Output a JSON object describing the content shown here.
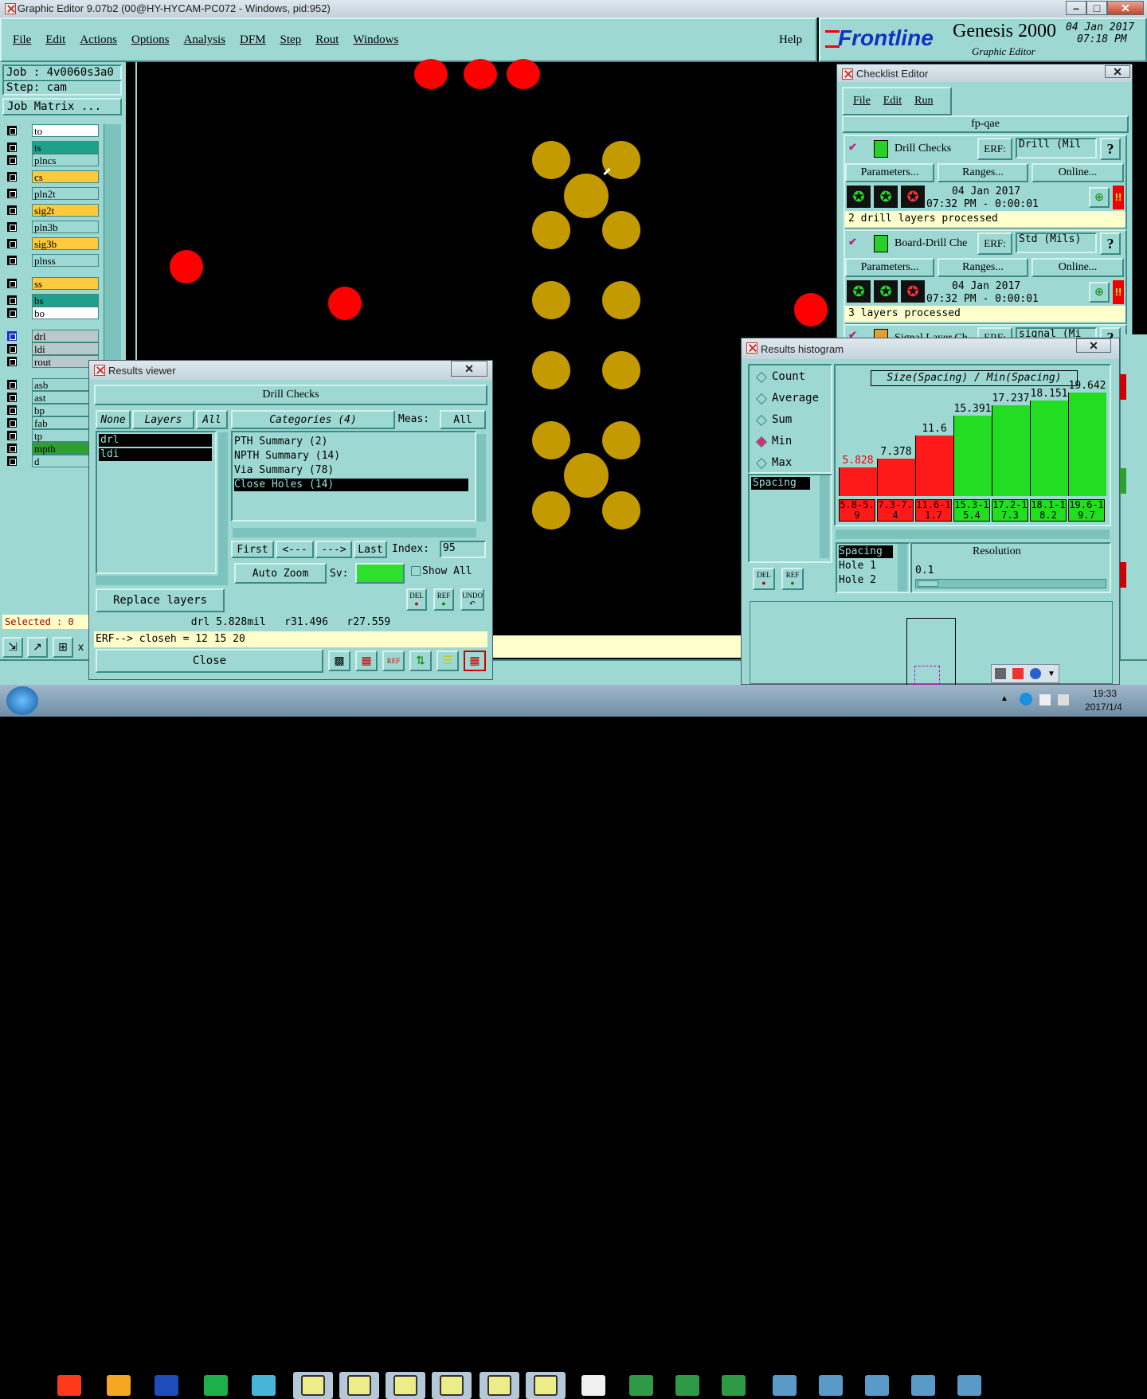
{
  "window": {
    "title": "Graphic Editor 9.07b2 (00@HY-HYCAM-PC072 - Windows, pid:952)"
  },
  "menu": {
    "items": [
      "File",
      "Edit",
      "Actions",
      "Options",
      "Analysis",
      "DFM",
      "Step",
      "Rout",
      "Windows"
    ],
    "help": "Help"
  },
  "brand": {
    "logo": "Frontline",
    "product": "Genesis 2000",
    "subtitle": "Graphic Editor",
    "date": "04 Jan 2017",
    "time": "07:18 PM"
  },
  "job": {
    "job": "Job : 4v0060s3a0",
    "step": "Step: cam",
    "matrix": "Job Matrix ..."
  },
  "layers": [
    "to",
    "ts",
    "plncs",
    "cs",
    "pln2t",
    "sig2t",
    "pln3b",
    "sig3b",
    "plnss",
    "ss",
    "bs",
    "bo",
    "drl",
    "ldi",
    "rout",
    "asb",
    "ast",
    "bp",
    "fab",
    "tp",
    "mpth",
    "d"
  ],
  "layer_colors": {
    "to": "#ffffff",
    "ts": "#1fa08c",
    "cs": "#ffc93c",
    "sig2t": "#ffc93c",
    "sig3b": "#ffc93c",
    "ss": "#ffc93c",
    "bs": "#1fa08c",
    "bo": "#ffffff",
    "drl": "#b9c9cb",
    "ldi": "#b9c9cb",
    "rout": "#b9c9cb",
    "mpth": "#2fa02f"
  },
  "selected": "Selected : 0",
  "checklist": {
    "title": "Checklist Editor",
    "menu": [
      "File",
      "Edit",
      "Run"
    ],
    "name": "fp-qae",
    "checks": [
      {
        "name": "Drill Checks",
        "erf_label": "ERF:",
        "erf": "Drill (Mil",
        "params": "Parameters...",
        "ranges": "Ranges...",
        "online": "Online...",
        "date": "04 Jan 2017",
        "time": "07:32 PM - 0:00:01",
        "status": "2 drill layers processed",
        "help": "?"
      },
      {
        "name": "Board-Drill Che",
        "erf_label": "ERF:",
        "erf": "Std (Mils)",
        "params": "Parameters...",
        "ranges": "Ranges...",
        "online": "Online...",
        "date": "04 Jan 2017",
        "time": "07:32 PM - 0:00:01",
        "status": "3 layers processed",
        "help": "?"
      },
      {
        "name": "Signal Layer Ch",
        "erf_label": "ERF:",
        "erf": "signal (Mi",
        "help": "?"
      }
    ]
  },
  "results_viewer": {
    "title": "Results viewer",
    "header": "Drill Checks",
    "none": "None",
    "layers_label": "Layers",
    "all": "All",
    "categories": "Categories (4)",
    "meas_label": "Meas:",
    "meas_value": "All",
    "layer_list": [
      "drl",
      "ldi"
    ],
    "category_list": [
      "PTH Summary (2)",
      "NPTH Summary (14)",
      "Via Summary (78)",
      "Close Holes (14)"
    ],
    "first": "First",
    "prev": "<---",
    "next": "--->",
    "last": "Last",
    "index_label": "Index:",
    "index_value": "95",
    "auto_zoom": "Auto Zoom",
    "sv": "Sv:",
    "show_all": "Show All",
    "replace": "Replace layers",
    "del": "DEL",
    "ref": "REF",
    "undo": "UNDO",
    "measure": "drl 5.828mil   r31.496   r27.559",
    "erf_line": "ERF--> closeh = 12 15 20",
    "close": "Close"
  },
  "histogram": {
    "title": "Results histogram",
    "heading": "Size(Spacing) / Min(Spacing)",
    "options": [
      "Count",
      "Average",
      "Sum",
      "Min",
      "Max"
    ],
    "selected_option": "Min",
    "list": [
      "Spacing"
    ],
    "list2": [
      "Spacing",
      "Hole 1",
      "Hole 2"
    ],
    "resolution_label": "Resolution",
    "resolution": "0.1",
    "del": "DEL",
    "ref": "REF"
  },
  "chart_data": {
    "type": "bar",
    "title": "Size(Spacing) / Min(Spacing)",
    "categories": [
      "5.8-5.9",
      "7.3-7.4",
      "11.6-11.7",
      "15.3-15.4",
      "17.2-17.3",
      "18.1-18.2",
      "19.6-19.7"
    ],
    "values": [
      5.828,
      7.378,
      11.6,
      15.391,
      17.237,
      18.151,
      19.642
    ],
    "value_labels": [
      "5.828",
      "7.378",
      "11.6",
      "15.391",
      "17.237",
      "18.151",
      "19.642"
    ],
    "colors": [
      "#ff1a1a",
      "#ff1a1a",
      "#ff1a1a",
      "#22dd22",
      "#22dd22",
      "#22dd22",
      "#22dd22"
    ],
    "ylim": [
      0,
      19.642
    ],
    "grid": false,
    "legend": "none"
  },
  "taskbar": {
    "time": "19:33",
    "date": "2017/1/4"
  }
}
